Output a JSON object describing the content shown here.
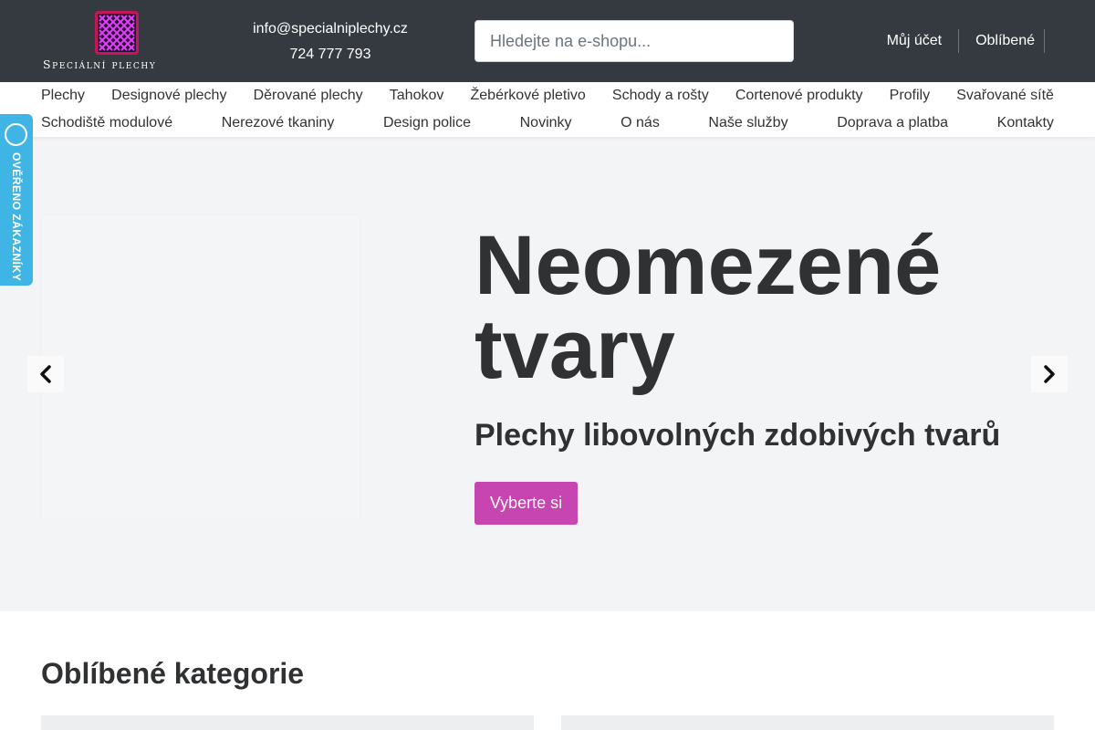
{
  "brand": {
    "name": "Speciální plechy",
    "logo_icon": "woven-mesh-icon",
    "logo_color": "#c2185b"
  },
  "header": {
    "email": "info@specialniplechy.cz",
    "phone": "724 777 793",
    "search_placeholder": "Hledejte na e-shopu...",
    "account_label": "Můj účet",
    "favorites_label": "Oblíbené"
  },
  "nav": {
    "row1": [
      "Plechy",
      "Designové plechy",
      "Děrované plechy",
      "Tahokov",
      "Žebérkové pletivo",
      "Schody a rošty",
      "Cortenové produkty",
      "Profily",
      "Svařované sítě"
    ],
    "row2": [
      "Schodiště modulové",
      "Nerezové tkaniny",
      "Design police",
      "Novinky",
      "O nás",
      "Naše služby",
      "Doprava a platba",
      "Kontakty"
    ]
  },
  "hero": {
    "title": "Neomezené tvary",
    "subtitle": "Plechy libovolných zdobivých tvarů",
    "cta_label": "Vyberte si",
    "prev_icon": "chevron-left-icon",
    "next_icon": "chevron-right-icon",
    "accent_color": "#c645b0"
  },
  "badge": {
    "text": "OVĚŘENO ZÁKAZNÍKY",
    "icon": "verified-circle-icon",
    "color": "#3fb5e5"
  },
  "categories": {
    "heading": "Oblíbené kategorie"
  }
}
